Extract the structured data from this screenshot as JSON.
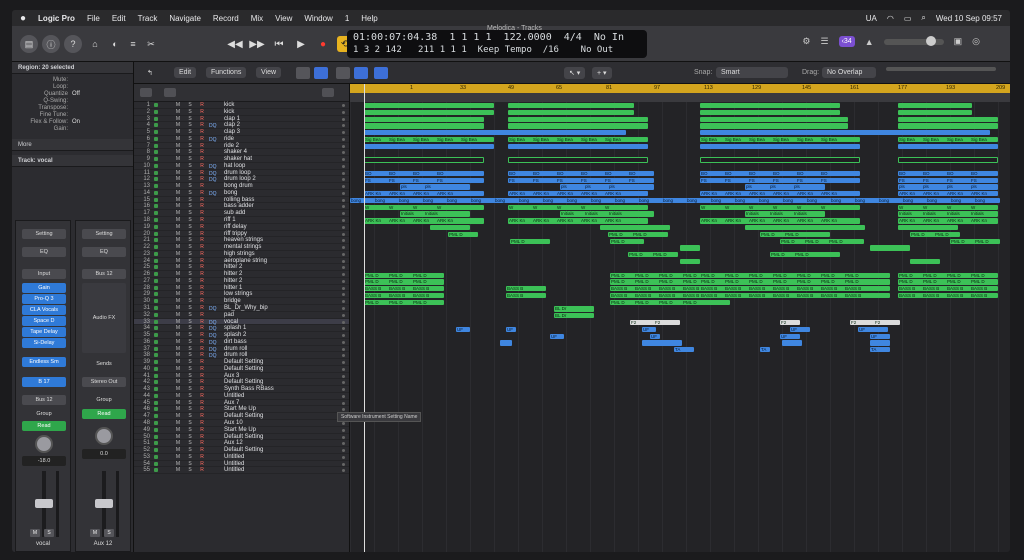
{
  "menubar": {
    "apple": "",
    "app": "Logic Pro",
    "items": [
      "File",
      "Edit",
      "Track",
      "Navigate",
      "Record",
      "Mix",
      "View",
      "Window",
      "1",
      "Help"
    ],
    "right": [
      "UA",
      "Wed 10 Sep 09:57"
    ]
  },
  "window": {
    "title": "Melodica - Tracks"
  },
  "lcd": {
    "time": "01:00:07:04.38",
    "bars_top": "1  1  1    1",
    "bars": "1  3  2  142",
    "pos_bottom": "211  1  1    1",
    "tempo": "122.0000",
    "tempo_mode": "Keep Tempo",
    "sig": "4/4",
    "division": "/16",
    "in": "No In",
    "out": "No Out"
  },
  "toolbar": {
    "badge": "‹34"
  },
  "inspector": {
    "region_header": "Region: 20 selected",
    "rows": [
      {
        "k": "Mute:",
        "v": ""
      },
      {
        "k": "Loop:",
        "v": ""
      },
      {
        "k": "Quantize",
        "v": "Off"
      },
      {
        "k": "Q-Swing:",
        "v": ""
      },
      {
        "k": "Transpose:",
        "v": ""
      },
      {
        "k": "Fine Tune:",
        "v": ""
      },
      {
        "k": "Flex & Follow:",
        "v": "On"
      },
      {
        "k": "Gain:",
        "v": ""
      }
    ],
    "more": "More",
    "track_header": "Track: vocal"
  },
  "strip1": {
    "setting": "Setting",
    "eq": "EQ",
    "input": "Input",
    "plugins": [
      "Gain",
      "Pro-Q 3",
      "CLA Vocals",
      "Space D",
      "Tape Delay",
      "Si-Delay"
    ],
    "send": "Endless Sm",
    "io1": "B 17",
    "io2": "Bus 12",
    "group": "Group",
    "read": "Read",
    "vol": "-18.0",
    "name": "vocal"
  },
  "strip2": {
    "setting": "Setting",
    "eq": "EQ",
    "bus": "Bus 12",
    "fx": "Audio FX",
    "sends": "Sends",
    "out": "Stereo Out",
    "group": "Group",
    "read": "Read",
    "vol": "0.0",
    "name": "Aux 12"
  },
  "tracks_toolbar": {
    "edit": "Edit",
    "functions": "Functions",
    "view": "View",
    "snap_label": "Snap:",
    "snap": "Smart",
    "drag_label": "Drag:",
    "drag": "No Overlap"
  },
  "ruler": {
    "bars": [
      "1",
      "33",
      "49",
      "65",
      "81",
      "97",
      "113",
      "129",
      "145",
      "161",
      "177",
      "193",
      "209"
    ]
  },
  "tracks": [
    {
      "n": "1",
      "name": "kick",
      "dq": ""
    },
    {
      "n": "2",
      "name": "kick",
      "dq": ""
    },
    {
      "n": "3",
      "name": "clap 1",
      "dq": ""
    },
    {
      "n": "4",
      "name": "clap 2",
      "dq": "DQ"
    },
    {
      "n": "5",
      "name": "clap 3",
      "dq": ""
    },
    {
      "n": "6",
      "name": "ride",
      "dq": "DQ"
    },
    {
      "n": "7",
      "name": "ride 2",
      "dq": ""
    },
    {
      "n": "8",
      "name": "shaker 4",
      "dq": ""
    },
    {
      "n": "9",
      "name": "shaker hat",
      "dq": ""
    },
    {
      "n": "10",
      "name": "hat loop",
      "dq": "DQ"
    },
    {
      "n": "11",
      "name": "drum loop",
      "dq": "DQ"
    },
    {
      "n": "12",
      "name": "drum loop 2",
      "dq": "DQ"
    },
    {
      "n": "13",
      "name": "bong drum",
      "dq": ""
    },
    {
      "n": "14",
      "name": "bong",
      "dq": "DQ"
    },
    {
      "n": "15",
      "name": "rolling bass",
      "dq": ""
    },
    {
      "n": "16",
      "name": "bass adder",
      "dq": ""
    },
    {
      "n": "17",
      "name": "sub add",
      "dq": ""
    },
    {
      "n": "18",
      "name": "riff 1",
      "dq": ""
    },
    {
      "n": "19",
      "name": "riff delay",
      "dq": ""
    },
    {
      "n": "20",
      "name": "riff trippy",
      "dq": ""
    },
    {
      "n": "21",
      "name": "heaven strings",
      "dq": ""
    },
    {
      "n": "22",
      "name": "mental strings",
      "dq": ""
    },
    {
      "n": "23",
      "name": "high strings",
      "dq": ""
    },
    {
      "n": "24",
      "name": "aeroplane string",
      "dq": ""
    },
    {
      "n": "25",
      "name": "hitter 2",
      "dq": ""
    },
    {
      "n": "26",
      "name": "hitter 2",
      "dq": ""
    },
    {
      "n": "27",
      "name": "hitter 2",
      "dq": ""
    },
    {
      "n": "28",
      "name": "hitter 1",
      "dq": ""
    },
    {
      "n": "29",
      "name": "low strings",
      "dq": ""
    },
    {
      "n": "30",
      "name": "bridge",
      "dq": ""
    },
    {
      "n": "31",
      "name": "BL_Dr_Why_bip",
      "dq": "DQ"
    },
    {
      "n": "32",
      "name": "pad",
      "dq": ""
    },
    {
      "n": "33",
      "name": "vocal",
      "dq": "DQ"
    },
    {
      "n": "34",
      "name": "splash 1",
      "dq": "DQ"
    },
    {
      "n": "35",
      "name": "splash 2",
      "dq": "DQ"
    },
    {
      "n": "36",
      "name": "dirt bass",
      "dq": "DQ"
    },
    {
      "n": "37",
      "name": "drum roll",
      "dq": "DQ"
    },
    {
      "n": "38",
      "name": "drum roll",
      "dq": "DQ"
    },
    {
      "n": "39",
      "name": "Default Setting",
      "dq": ""
    },
    {
      "n": "40",
      "name": "Default Setting",
      "dq": ""
    },
    {
      "n": "41",
      "name": "Aux 3",
      "dq": ""
    },
    {
      "n": "42",
      "name": "Default Setting",
      "dq": ""
    },
    {
      "n": "43",
      "name": "Synth Bass RBass",
      "dq": ""
    },
    {
      "n": "44",
      "name": "Untitled",
      "dq": ""
    },
    {
      "n": "45",
      "name": "Aux 7",
      "dq": ""
    },
    {
      "n": "46",
      "name": "Start Me Up",
      "dq": ""
    },
    {
      "n": "47",
      "name": "Default Setting",
      "dq": ""
    },
    {
      "n": "48",
      "name": "Aux 10",
      "dq": ""
    },
    {
      "n": "49",
      "name": "Start Me Up",
      "dq": ""
    },
    {
      "n": "50",
      "name": "Default Setting",
      "dq": ""
    },
    {
      "n": "51",
      "name": "Aux 12",
      "dq": ""
    },
    {
      "n": "52",
      "name": "Default Setting",
      "dq": ""
    },
    {
      "n": "53",
      "name": "Untitled",
      "dq": ""
    },
    {
      "n": "54",
      "name": "Untitled",
      "dq": ""
    },
    {
      "n": "55",
      "name": "Untitled",
      "dq": ""
    }
  ],
  "msr": {
    "m": "M",
    "s": "S",
    "r": "R"
  },
  "tooltip": "Software Instrument Setting Name",
  "region_labels": {
    "sig": "Sig Bea",
    "bo": "BO",
    "fs": "FS",
    "pls": "pls",
    "ark": "ARK Kn",
    "bong": "bong",
    "w": "W",
    "initial": "Initials",
    "pml": "PML D",
    "bass": "BASS B",
    "bl": "BL Dr",
    "uf": "UF",
    "f2": "F2",
    "ta": "TA"
  },
  "colors": {
    "green": "#3cc157",
    "blue": "#3f86e0",
    "ruler": "#d4a51e",
    "record": "#ff3b30"
  }
}
